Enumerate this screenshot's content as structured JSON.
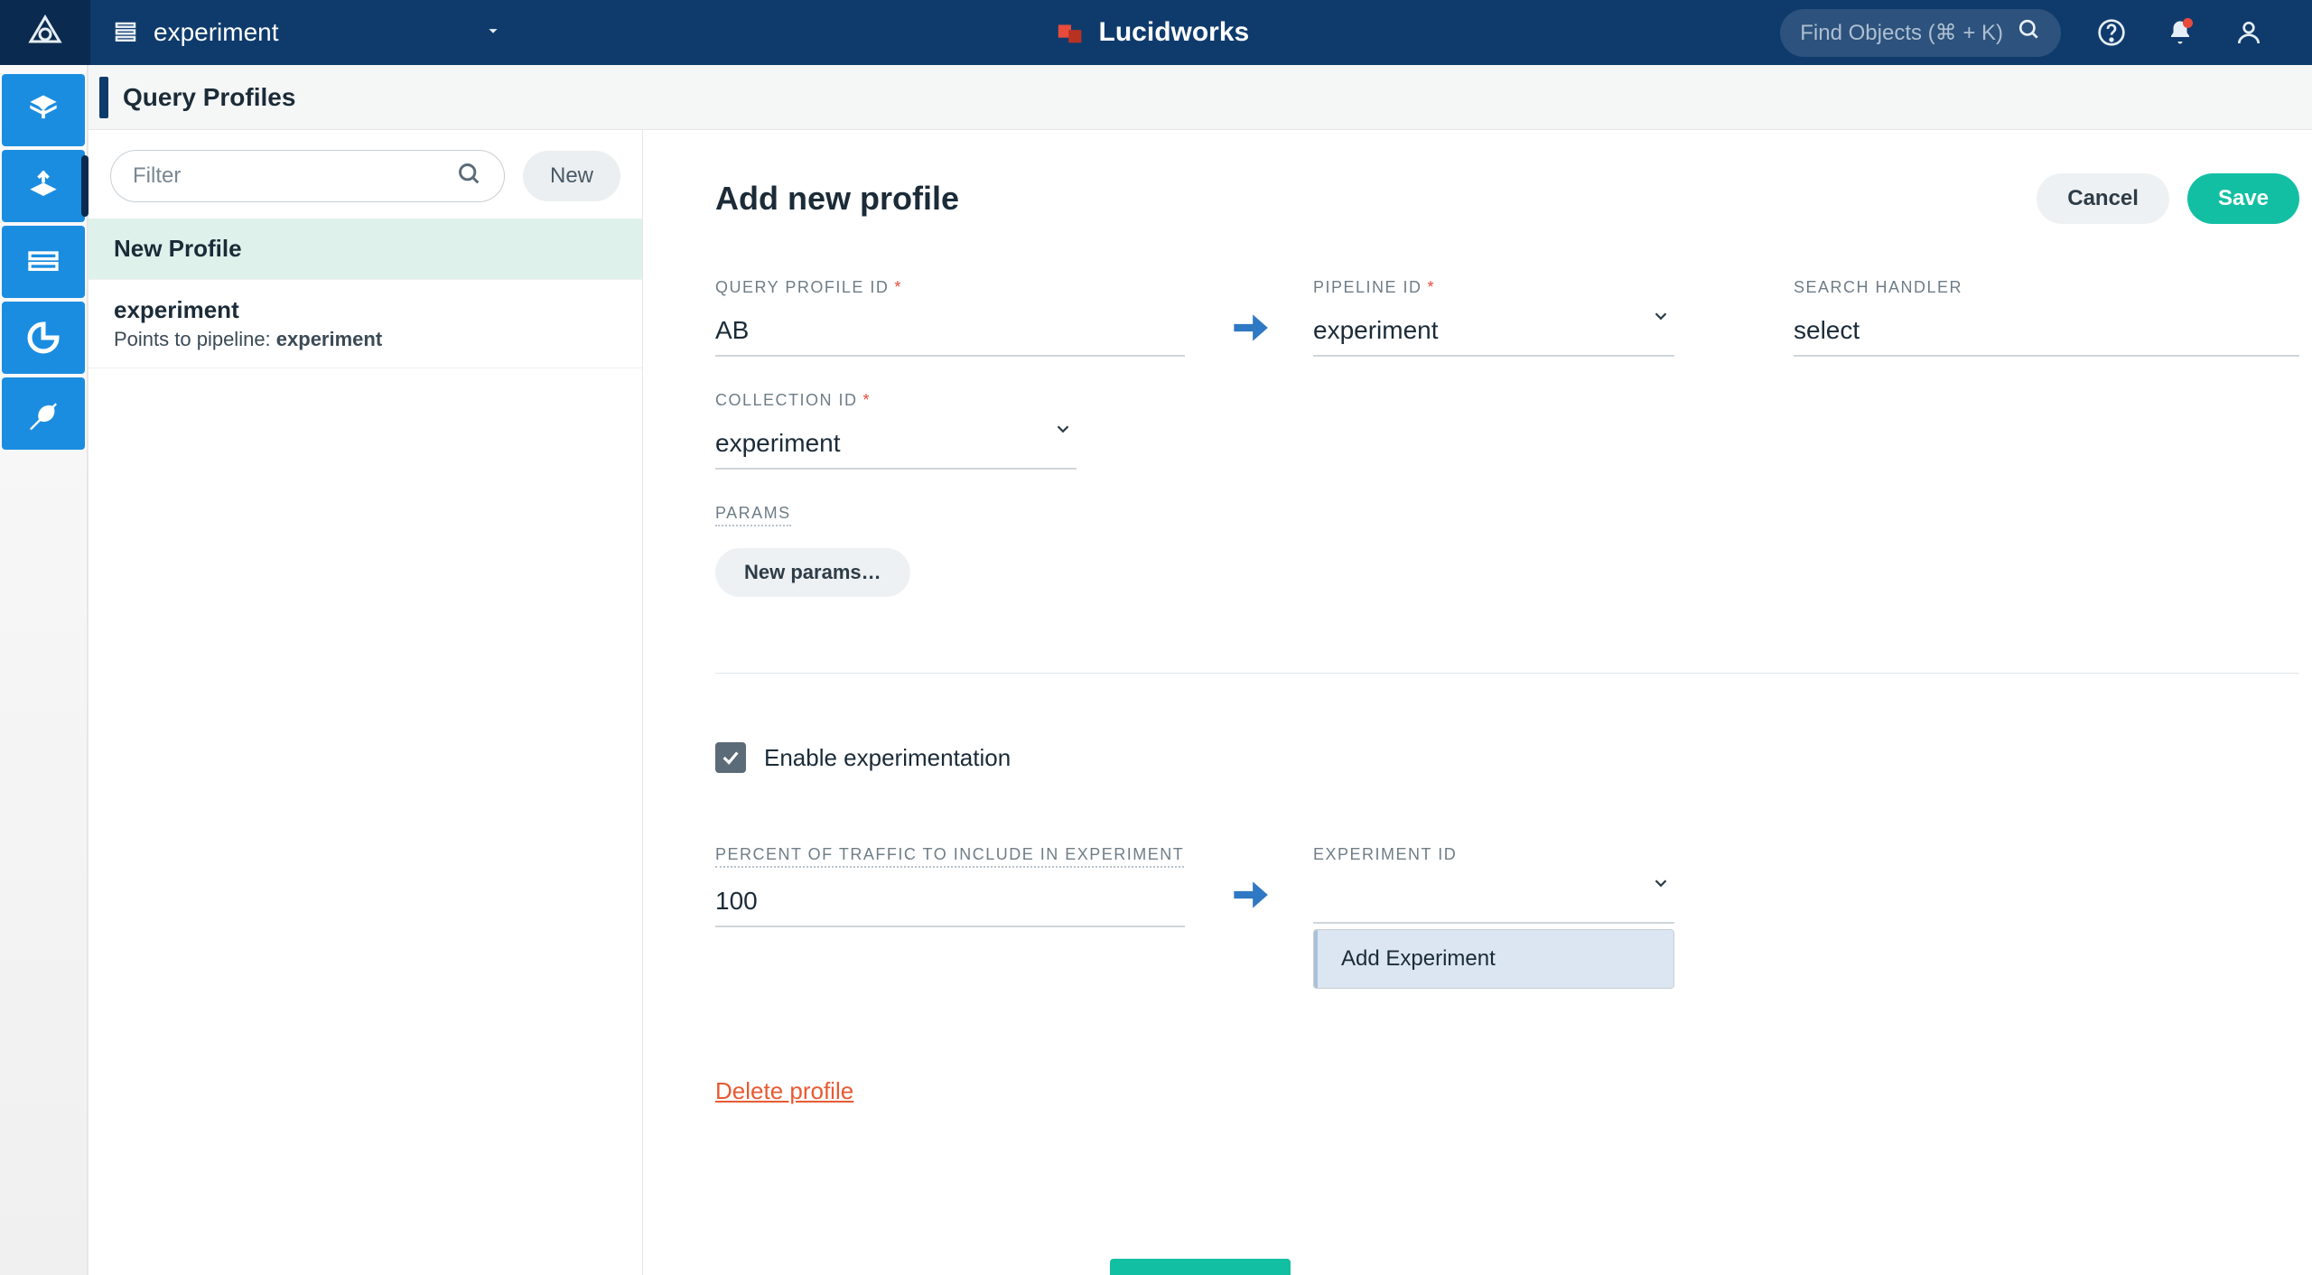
{
  "header": {
    "collection_name": "experiment",
    "brand_text": "Lucidworks",
    "find_objects_placeholder": "Find Objects (⌘ + K)"
  },
  "panel": {
    "title": "Query Profiles"
  },
  "sidebar": {
    "filter_placeholder": "Filter",
    "new_button": "New",
    "items": [
      {
        "label": "New Profile",
        "selected": true
      },
      {
        "label": "experiment",
        "sublabel_prefix": "Points to pipeline: ",
        "sublabel_value": "experiment",
        "selected": false
      }
    ]
  },
  "form": {
    "title": "Add new profile",
    "cancel": "Cancel",
    "save": "Save",
    "fields": {
      "query_profile_id": {
        "label": "QUERY PROFILE ID",
        "value": "AB",
        "required": true
      },
      "pipeline_id": {
        "label": "PIPELINE ID",
        "value": "experiment",
        "required": true
      },
      "search_handler": {
        "label": "SEARCH HANDLER",
        "value": "select",
        "required": false
      },
      "collection_id": {
        "label": "COLLECTION ID",
        "value": "experiment",
        "required": true
      },
      "params_label": "PARAMS",
      "new_params": "New params…",
      "enable_experimentation_label": "Enable experimentation",
      "enable_experimentation_checked": true,
      "percent_traffic": {
        "label": "PERCENT OF TRAFFIC TO INCLUDE IN EXPERIMENT",
        "value": "100"
      },
      "experiment_id": {
        "label": "EXPERIMENT ID",
        "value": ""
      },
      "experiment_dropdown_option": "Add Experiment",
      "delete_profile": "Delete profile"
    }
  },
  "colors": {
    "header_bg": "#0f3b6c",
    "brand_bg": "#0a2b4f",
    "rail_active": "#1b8de0",
    "teal": "#13bfa3",
    "danger": "#e85a32"
  }
}
